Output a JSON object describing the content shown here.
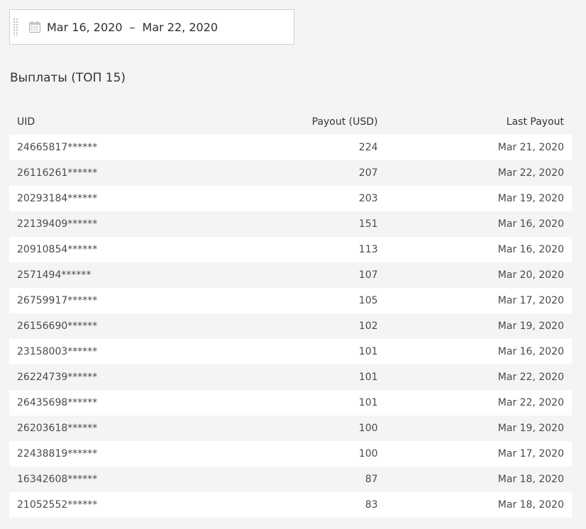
{
  "date_range": {
    "start": "Mar 16, 2020",
    "separator": "–",
    "end": "Mar 22, 2020",
    "icon": "calendar-icon"
  },
  "section": {
    "title": "Выплаты (ТОП 15)"
  },
  "table": {
    "headers": {
      "uid": "UID",
      "payout": "Payout (USD)",
      "last_payout": "Last Payout"
    },
    "rows": [
      {
        "uid": "24665817******",
        "payout": "224",
        "last_payout": "Mar 21, 2020"
      },
      {
        "uid": "26116261******",
        "payout": "207",
        "last_payout": "Mar 22, 2020"
      },
      {
        "uid": "20293184******",
        "payout": "203",
        "last_payout": "Mar 19, 2020"
      },
      {
        "uid": "22139409******",
        "payout": "151",
        "last_payout": "Mar 16, 2020"
      },
      {
        "uid": "20910854******",
        "payout": "113",
        "last_payout": "Mar 16, 2020"
      },
      {
        "uid": "2571494******",
        "payout": "107",
        "last_payout": "Mar 20, 2020"
      },
      {
        "uid": "26759917******",
        "payout": "105",
        "last_payout": "Mar 17, 2020"
      },
      {
        "uid": "26156690******",
        "payout": "102",
        "last_payout": "Mar 19, 2020"
      },
      {
        "uid": "23158003******",
        "payout": "101",
        "last_payout": "Mar 16, 2020"
      },
      {
        "uid": "26224739******",
        "payout": "101",
        "last_payout": "Mar 22, 2020"
      },
      {
        "uid": "26435698******",
        "payout": "101",
        "last_payout": "Mar 22, 2020"
      },
      {
        "uid": "26203618******",
        "payout": "100",
        "last_payout": "Mar 19, 2020"
      },
      {
        "uid": "22438819******",
        "payout": "100",
        "last_payout": "Mar 17, 2020"
      },
      {
        "uid": "16342608******",
        "payout": "87",
        "last_payout": "Mar 18, 2020"
      },
      {
        "uid": "21052552******",
        "payout": "83",
        "last_payout": "Mar 18, 2020"
      }
    ]
  }
}
